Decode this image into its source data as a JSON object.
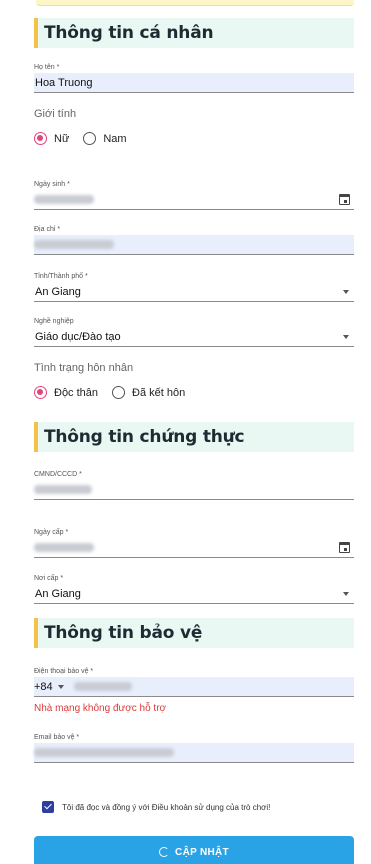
{
  "sections": {
    "personal": "Thông tin cá nhân",
    "verification": "Thông tin chứng thực",
    "security": "Thông tin bảo vệ"
  },
  "personal": {
    "fullname": {
      "label": "Họ tên *",
      "value": "Hoa Truong"
    },
    "gender": {
      "title": "Giới tính",
      "options": [
        {
          "label": "Nữ",
          "selected": true
        },
        {
          "label": "Nam",
          "selected": false
        }
      ]
    },
    "birthday": {
      "label": "Ngày sinh *",
      "value": ""
    },
    "address": {
      "label": "Địa chỉ *",
      "value": ""
    },
    "city": {
      "label": "Tỉnh/Thành phố *",
      "value": "An Giang"
    },
    "job": {
      "label": "Nghề nghiệp",
      "value": "Giáo dục/Đào tạo"
    },
    "marital": {
      "title": "Tình trạng hôn nhân",
      "options": [
        {
          "label": "Độc thân",
          "selected": true
        },
        {
          "label": "Đã kết hôn",
          "selected": false
        }
      ]
    }
  },
  "verification": {
    "id_number": {
      "label": "CMND/CCCD *",
      "value": ""
    },
    "issue_date": {
      "label": "Ngày cấp *",
      "value": ""
    },
    "issue_place": {
      "label": "Nơi cấp *",
      "value": "An Giang"
    }
  },
  "security": {
    "phone": {
      "label": "Điện thoại bảo vệ *",
      "prefix": "+84",
      "value": ""
    },
    "phone_error": "Nhà mạng không được hỗ trợ",
    "email": {
      "label": "Email bảo vệ *",
      "value": ""
    }
  },
  "agreement": {
    "text": "Tôi đã đọc và đồng ý với Điều khoản sử dụng của trò chơi!",
    "checked": true
  },
  "submit_label": "CẬP NHẬT",
  "colors": {
    "accent": "#2aa3e6",
    "radio": "#e0457b",
    "error": "#d93b3b",
    "section_bg": "#e9f8f2",
    "section_bar": "#f3c24b"
  }
}
